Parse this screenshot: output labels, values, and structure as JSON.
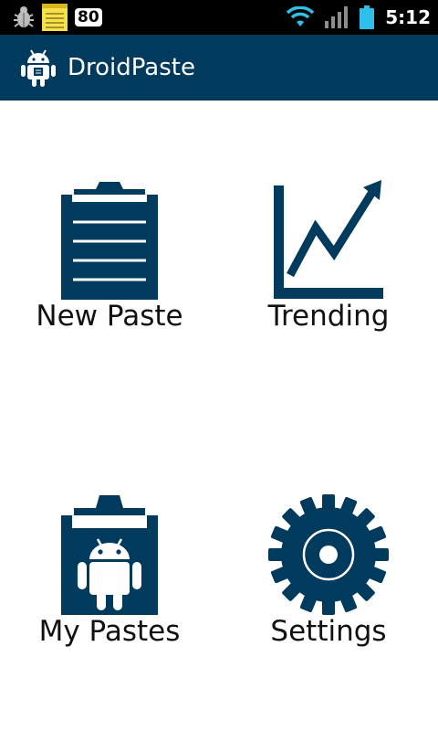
{
  "status_bar": {
    "notification_count": "80",
    "time": "5:12",
    "icons": [
      "bug-icon",
      "notes-icon",
      "wifi-icon",
      "signal-icon",
      "battery-icon"
    ]
  },
  "action_bar": {
    "title": "DroidPaste",
    "icon": "android-icon"
  },
  "tiles": [
    {
      "label": "New Paste",
      "icon": "clipboard-icon"
    },
    {
      "label": "Trending",
      "icon": "trending-chart-icon"
    },
    {
      "label": "My Pastes",
      "icon": "android-clipboard-icon"
    },
    {
      "label": "Settings",
      "icon": "gear-icon"
    }
  ],
  "colors": {
    "primary": "#003a5c",
    "status_bar": "#000000",
    "wifi": "#2ec0e8",
    "battery": "#2ec0e8",
    "label_text": "#111111"
  }
}
